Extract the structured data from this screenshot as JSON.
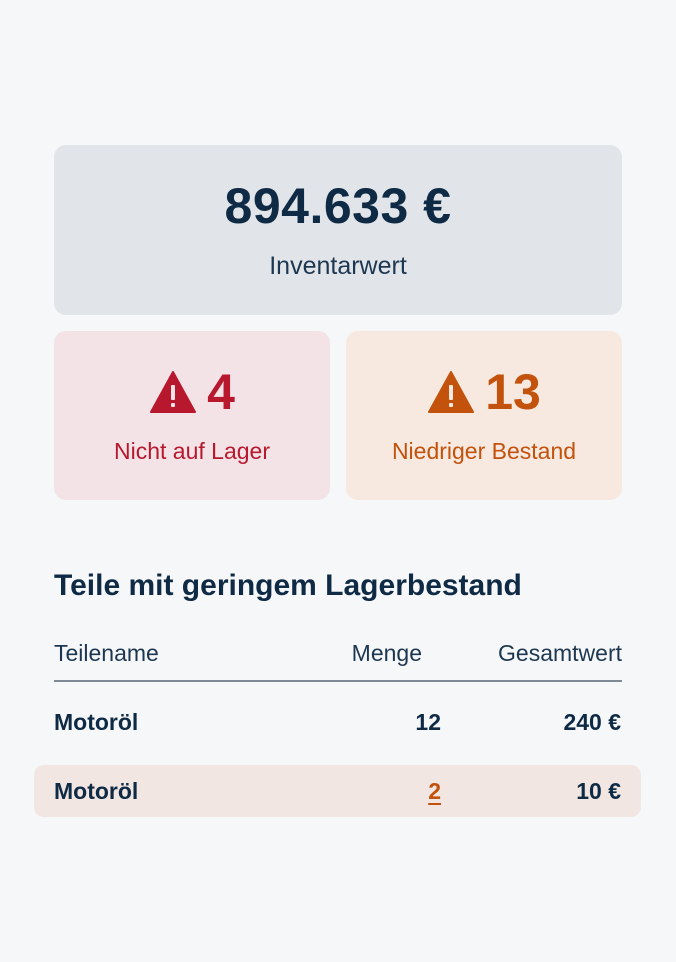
{
  "summary": {
    "inventory_value": "894.633 €",
    "inventory_label": "Inventarwert"
  },
  "stats": {
    "out_of_stock": {
      "count": "4",
      "label": "Nicht auf Lager",
      "icon": "warning-icon",
      "color": "#b8182e"
    },
    "low_stock": {
      "count": "13",
      "label": "Niedriger Bestand",
      "icon": "warning-icon",
      "color": "#c2520c"
    }
  },
  "low_stock_table": {
    "title": "Teile mit geringem Lagerbestand",
    "columns": [
      "Teilename",
      "Menge",
      "Gesamtwert"
    ],
    "rows": [
      {
        "name": "Motoröl",
        "quantity": "12",
        "total": "240 €"
      },
      {
        "name": "Motoröl",
        "quantity": "2",
        "total": "10 €"
      }
    ]
  }
}
